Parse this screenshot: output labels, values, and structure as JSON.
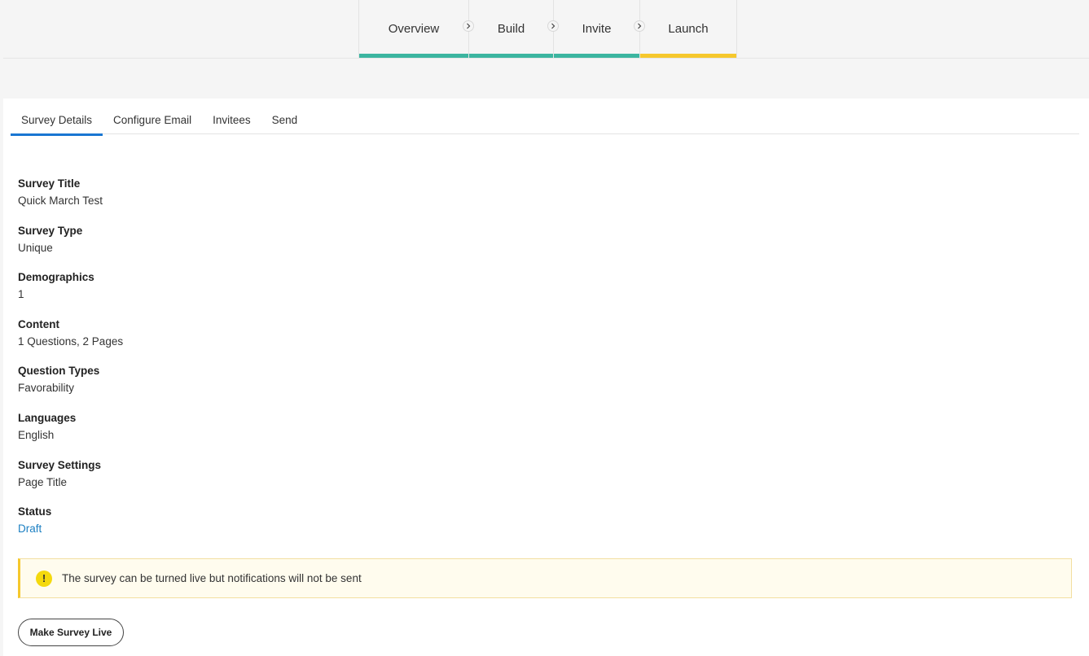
{
  "stepper": {
    "steps": [
      {
        "label": "Overview"
      },
      {
        "label": "Build"
      },
      {
        "label": "Invite"
      },
      {
        "label": "Launch"
      }
    ],
    "active": "Launch",
    "colors": {
      "completed": "#3cb5a0",
      "active": "#f6c82d"
    }
  },
  "tabs": [
    {
      "label": "Survey Details"
    },
    {
      "label": "Configure Email"
    },
    {
      "label": "Invitees"
    },
    {
      "label": "Send"
    }
  ],
  "active_tab": "Survey Details",
  "details": [
    {
      "label": "Survey Title",
      "value": "Quick March Test"
    },
    {
      "label": "Survey Type",
      "value": "Unique"
    },
    {
      "label": "Demographics",
      "value": "1"
    },
    {
      "label": "Content",
      "value": "1 Questions, 2 Pages"
    },
    {
      "label": "Question Types",
      "value": "Favorability"
    },
    {
      "label": "Languages",
      "value": "English"
    },
    {
      "label": "Survey Settings",
      "value": "Page Title"
    },
    {
      "label": "Status",
      "value": "Draft"
    }
  ],
  "alert": {
    "icon": "warning-icon",
    "icon_glyph": "!",
    "text": "The survey can be turned live but notifications will not be sent"
  },
  "actions": {
    "make_live_label": "Make Survey Live"
  }
}
